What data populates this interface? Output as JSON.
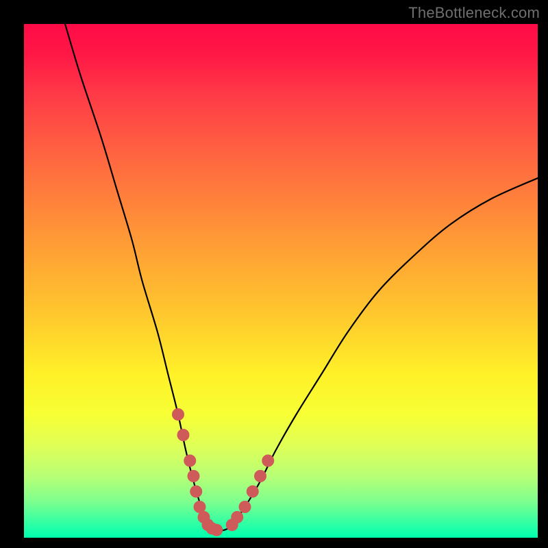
{
  "watermark": "TheBottleneck.com",
  "chart_data": {
    "type": "line",
    "title": "",
    "xlabel": "",
    "ylabel": "",
    "xlim": [
      0,
      100
    ],
    "ylim": [
      0,
      100
    ],
    "grid": false,
    "series": [
      {
        "name": "bottleneck-curve",
        "x": [
          8,
          11,
          15,
          18,
          21,
          23,
          26,
          28,
          30,
          31.5,
          33,
          34.5,
          36,
          37.5,
          39,
          40.5,
          43,
          46,
          49,
          53,
          58,
          63,
          69,
          76,
          83,
          91,
          100
        ],
        "y": [
          100,
          90,
          78,
          68,
          58,
          50,
          40,
          32,
          24,
          17,
          11,
          6,
          2.5,
          1.5,
          1.5,
          2.5,
          6,
          11,
          17,
          24,
          32,
          40,
          48,
          55,
          61,
          66,
          70
        ]
      }
    ],
    "markers": [
      {
        "name": "left-dots",
        "color": "#cf5a5a",
        "x": [
          30,
          31,
          32.3,
          33,
          33.5,
          34.2,
          35,
          35.8,
          36.6,
          37.5
        ],
        "y": [
          24,
          20,
          15,
          12,
          9,
          6,
          4,
          2.5,
          1.8,
          1.5
        ]
      },
      {
        "name": "right-dots",
        "color": "#cf5a5a",
        "x": [
          40.5,
          41.5,
          43,
          44.5,
          46,
          47.5
        ],
        "y": [
          2.5,
          4,
          6,
          9,
          12,
          15
        ]
      }
    ],
    "background_gradient": {
      "direction": "top-to-bottom",
      "stops": [
        {
          "pos": 0.0,
          "color": "#ff0b47"
        },
        {
          "pos": 0.28,
          "color": "#ff6d3f"
        },
        {
          "pos": 0.56,
          "color": "#ffc62e"
        },
        {
          "pos": 0.76,
          "color": "#f7ff35"
        },
        {
          "pos": 1.0,
          "color": "#00ffb0"
        }
      ]
    }
  }
}
